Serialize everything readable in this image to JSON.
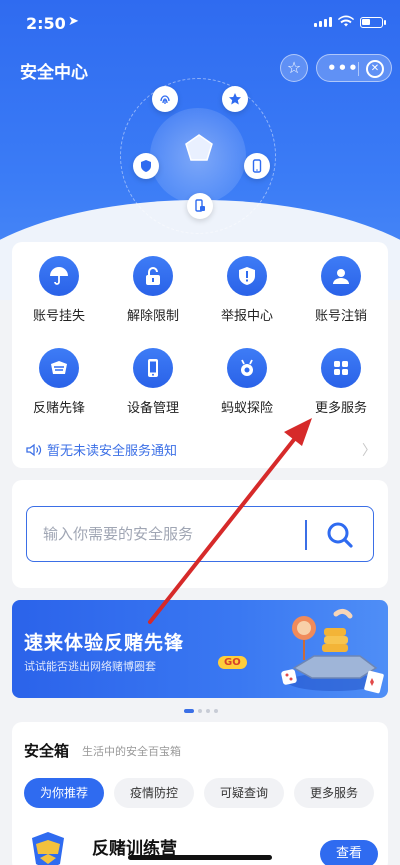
{
  "status": {
    "time": "2:50"
  },
  "header": {
    "title": "安全中心"
  },
  "grid": {
    "items": [
      {
        "label": "账号挂失",
        "icon": "umbrella-icon"
      },
      {
        "label": "解除限制",
        "icon": "unlock-icon"
      },
      {
        "label": "举报中心",
        "icon": "report-shield-icon"
      },
      {
        "label": "账号注销",
        "icon": "user-icon"
      },
      {
        "label": "反赌先锋",
        "icon": "anti-gamble-icon"
      },
      {
        "label": "设备管理",
        "icon": "phone-icon"
      },
      {
        "label": "蚂蚁探险",
        "icon": "ant-icon"
      },
      {
        "label": "更多服务",
        "icon": "more-grid-icon"
      }
    ],
    "notice": "暂无未读安全服务通知"
  },
  "search": {
    "placeholder": "输入你需要的安全服务"
  },
  "banner": {
    "title": "速来体验反赌先锋",
    "subtitle": "试试能否逃出网络赌博圈套",
    "go": "GO"
  },
  "box": {
    "title": "安全箱",
    "subtitle": "生活中的安全百宝箱",
    "tabs": [
      "为你推荐",
      "疫情防控",
      "可疑查询",
      "更多服务"
    ],
    "item": {
      "name": "反赌训练营",
      "action": "查看"
    }
  },
  "colors": {
    "primary": "#2f6bf0",
    "annotation": "#d62a2a"
  }
}
